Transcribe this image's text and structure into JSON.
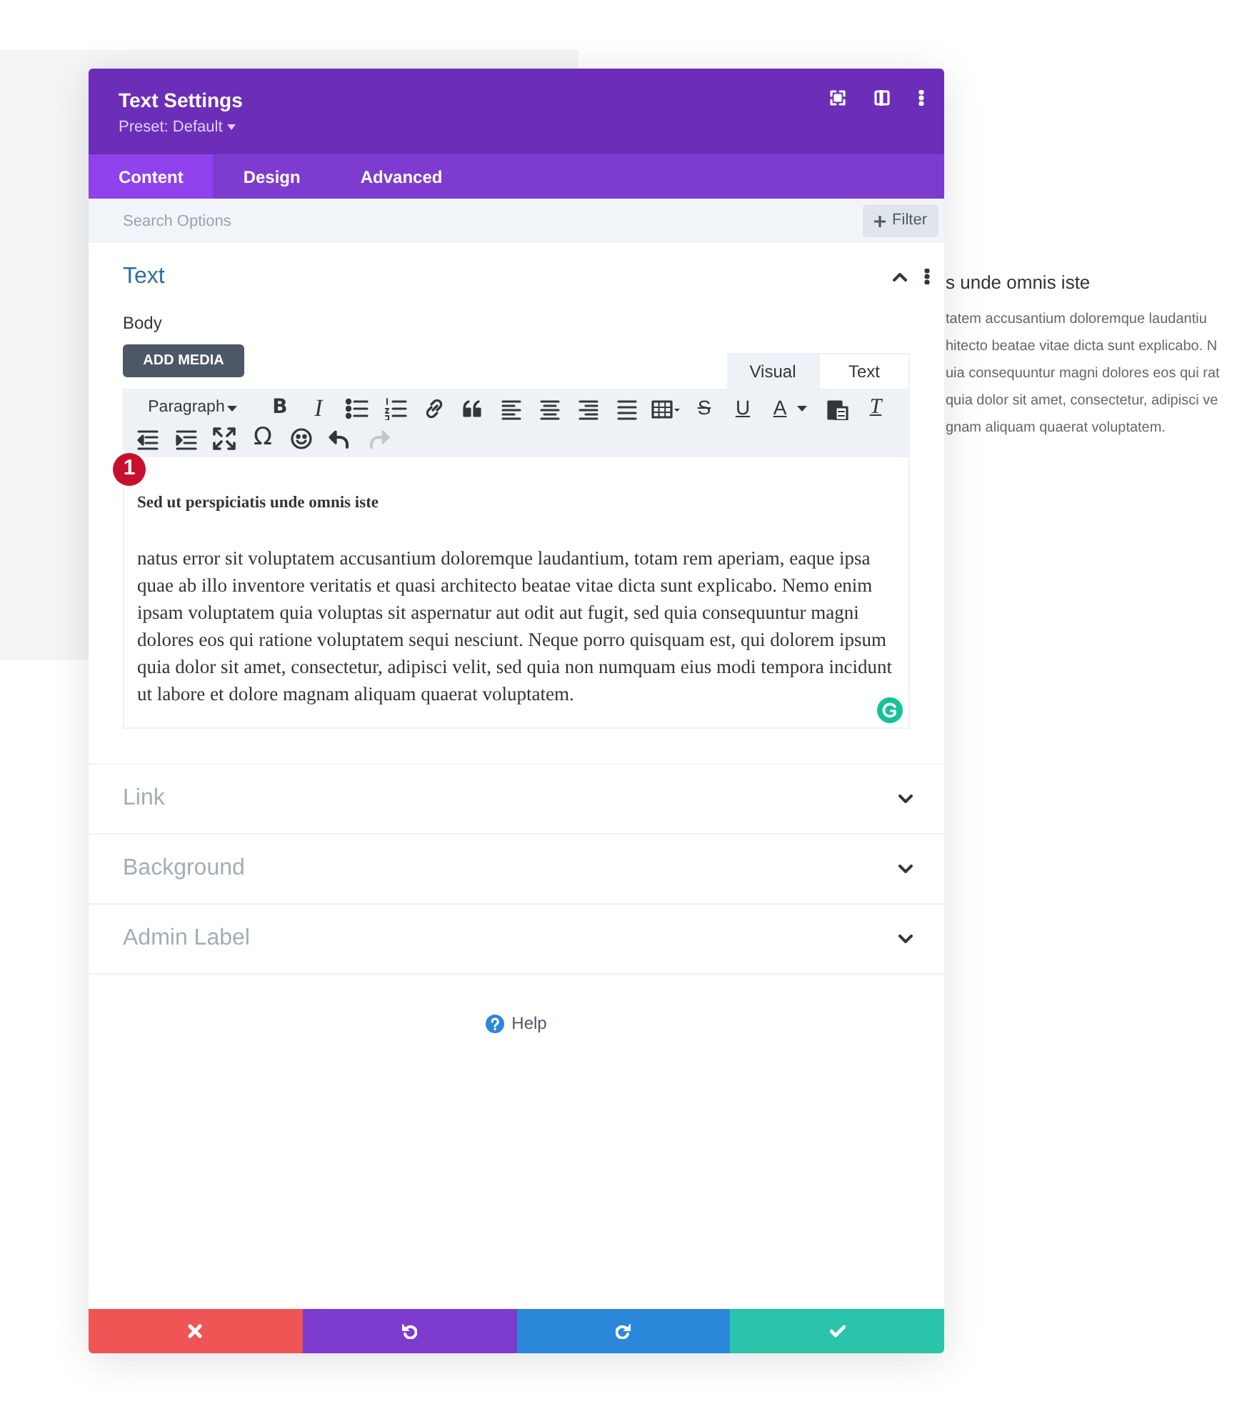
{
  "background_page": {
    "heading": "s unde omnis iste",
    "lines": [
      "tatem accusantium doloremque laudantiu",
      "hitecto beatae vitae dicta sunt explicabo. N",
      "uia consequuntur magni dolores eos qui rat",
      "quia dolor sit amet, consectetur, adipisci ve",
      "gnam aliquam quaerat voluptatem."
    ]
  },
  "modal": {
    "title": "Text Settings",
    "preset": "Preset: Default",
    "tabs": [
      {
        "label": "Content",
        "selected": true
      },
      {
        "label": "Design",
        "selected": false
      },
      {
        "label": "Advanced",
        "selected": false
      }
    ],
    "search": {
      "placeholder": "Search Options"
    },
    "filter_button": "Filter",
    "sections": [
      {
        "title": "Text",
        "expanded": true
      },
      {
        "title": "Link",
        "expanded": false
      },
      {
        "title": "Background",
        "expanded": false
      },
      {
        "title": "Admin Label",
        "expanded": false
      }
    ],
    "text_section": {
      "field_label": "Body",
      "add_media": "ADD MEDIA",
      "editor_tabs": [
        {
          "label": "Visual",
          "selected": true
        },
        {
          "label": "Text",
          "selected": false
        }
      ],
      "toolbar_rows": [
        [
          {
            "kind": "dropdown",
            "text": "Paragraph",
            "disabled": false
          },
          {
            "kind": "bold",
            "text": "B",
            "disabled": false
          },
          {
            "kind": "italic",
            "text": "I",
            "disabled": false
          },
          {
            "kind": "bullets",
            "disabled": false
          },
          {
            "kind": "numbers",
            "disabled": false
          },
          {
            "kind": "link",
            "disabled": false
          },
          {
            "kind": "quote",
            "disabled": false
          },
          {
            "kind": "align-left",
            "disabled": false
          },
          {
            "kind": "align-center",
            "disabled": false
          },
          {
            "kind": "align-right",
            "disabled": false
          },
          {
            "kind": "justify",
            "disabled": false
          },
          {
            "kind": "table",
            "disabled": false
          },
          {
            "kind": "strike",
            "text": "S",
            "disabled": false
          },
          {
            "kind": "underline",
            "text": "U",
            "disabled": false
          },
          {
            "kind": "color",
            "text": "A",
            "disabled": false
          },
          {
            "kind": "paste",
            "disabled": false
          },
          {
            "kind": "clear",
            "text": "T",
            "disabled": false
          }
        ],
        [
          {
            "kind": "outdent",
            "disabled": false
          },
          {
            "kind": "indent",
            "disabled": false
          },
          {
            "kind": "fullscreen",
            "disabled": false
          },
          {
            "kind": "symbol",
            "text": "Ω",
            "disabled": false
          },
          {
            "kind": "emoji",
            "disabled": false
          },
          {
            "kind": "undo",
            "disabled": false
          },
          {
            "kind": "redo",
            "disabled": true
          }
        ]
      ],
      "badge": "1",
      "content_heading": "Sed ut perspiciatis unde omnis iste",
      "content_paragraph": "natus error sit voluptatem accusantium doloremque laudantium, totam rem aperiam, eaque ipsa quae ab illo inventore veritatis et quasi architecto beatae vitae dicta sunt explicabo. Nemo enim ipsam voluptatem quia voluptas sit aspernatur aut odit aut fugit, sed quia consequuntur magni dolores eos qui ratione voluptatem sequi nesciunt. Neque porro quisquam est, qui dolorem ipsum quia dolor sit amet, consectetur, adipisci velit, sed quia non numquam eius modi tempora incidunt ut labore et dolore magnam aliquam quaerat voluptatem."
    },
    "help": "Help",
    "footer_buttons": [
      {
        "kind": "cancel",
        "color": "#ef5555"
      },
      {
        "kind": "undo",
        "color": "#7e3bd0"
      },
      {
        "kind": "redo",
        "color": "#2b87da"
      },
      {
        "kind": "save",
        "color": "#29c4a9"
      }
    ]
  }
}
